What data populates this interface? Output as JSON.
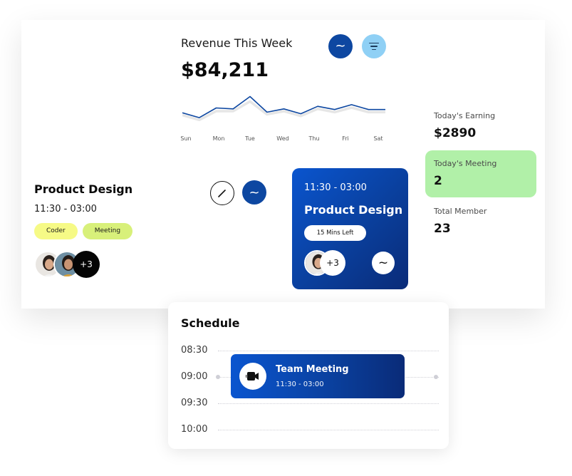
{
  "revenue": {
    "title": "Revenue This Week",
    "amount": "$84,211",
    "days": [
      "Sun",
      "Mon",
      "Tue",
      "Wed",
      "Thu",
      "Fri",
      "Sat"
    ],
    "trend_icon": "wave-icon",
    "filter_icon": "filter-icon",
    "accent_color": "#0d47a1",
    "filter_color": "#8fd0f5"
  },
  "chart_data": {
    "type": "line",
    "x": [
      "Sun",
      "",
      "Mon",
      "",
      "Tue",
      "",
      "Wed",
      "",
      "Thu",
      "",
      "Fri",
      "",
      "Sat"
    ],
    "series": [
      {
        "values": [
          50,
          35,
          65,
          62,
          100,
          52,
          62,
          47,
          70,
          60,
          75,
          60,
          60
        ]
      },
      {
        "values": [
          43,
          28,
          55,
          55,
          85,
          45,
          55,
          40,
          62,
          52,
          66,
          52,
          52
        ]
      }
    ],
    "ylim": [
      0,
      110
    ],
    "grid": false
  },
  "stats": {
    "earning": {
      "label": "Today's Earning",
      "value": "$2890"
    },
    "meeting": {
      "label": "Today's Meeting",
      "value": "2",
      "color": "#b1f0a8"
    },
    "member": {
      "label": "Total Member",
      "value": "23"
    }
  },
  "product_design": {
    "title": "Product Design",
    "time": "11:30 - 03:00",
    "tags": [
      "Coder",
      "Meeting"
    ],
    "more_count": "+3"
  },
  "blue_card": {
    "time": "11:30 - 03:00",
    "title": "Product Design",
    "pill": "15 Mins Left",
    "more_count": "+3"
  },
  "schedule": {
    "title": "Schedule",
    "times": [
      "08:30",
      "09:00",
      "09:30",
      "10:00"
    ],
    "event": {
      "title": "Team Meeting",
      "time": "11:30 - 03:00",
      "icon": "video-camera-icon"
    }
  }
}
